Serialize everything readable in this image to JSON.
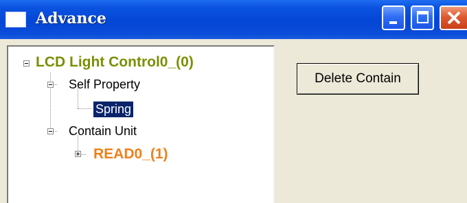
{
  "window": {
    "title": "Advance"
  },
  "titlebar_buttons": {
    "minimize": "minimize-icon",
    "maximize": "maximize-icon",
    "close": "close-icon"
  },
  "tree": {
    "root": "LCD Light Control0_(0)",
    "self_property": "Self Property",
    "spring": "Spring",
    "contain_unit": "Contain Unit",
    "read": "READ0_(1)"
  },
  "actions": {
    "delete_contain": "Delete Contain"
  },
  "colors": {
    "root_text": "#7a8f00",
    "read_text": "#f0801a",
    "selection": "#0a246a",
    "titlebar": "#0446d6",
    "close_button": "#de5a2f"
  }
}
